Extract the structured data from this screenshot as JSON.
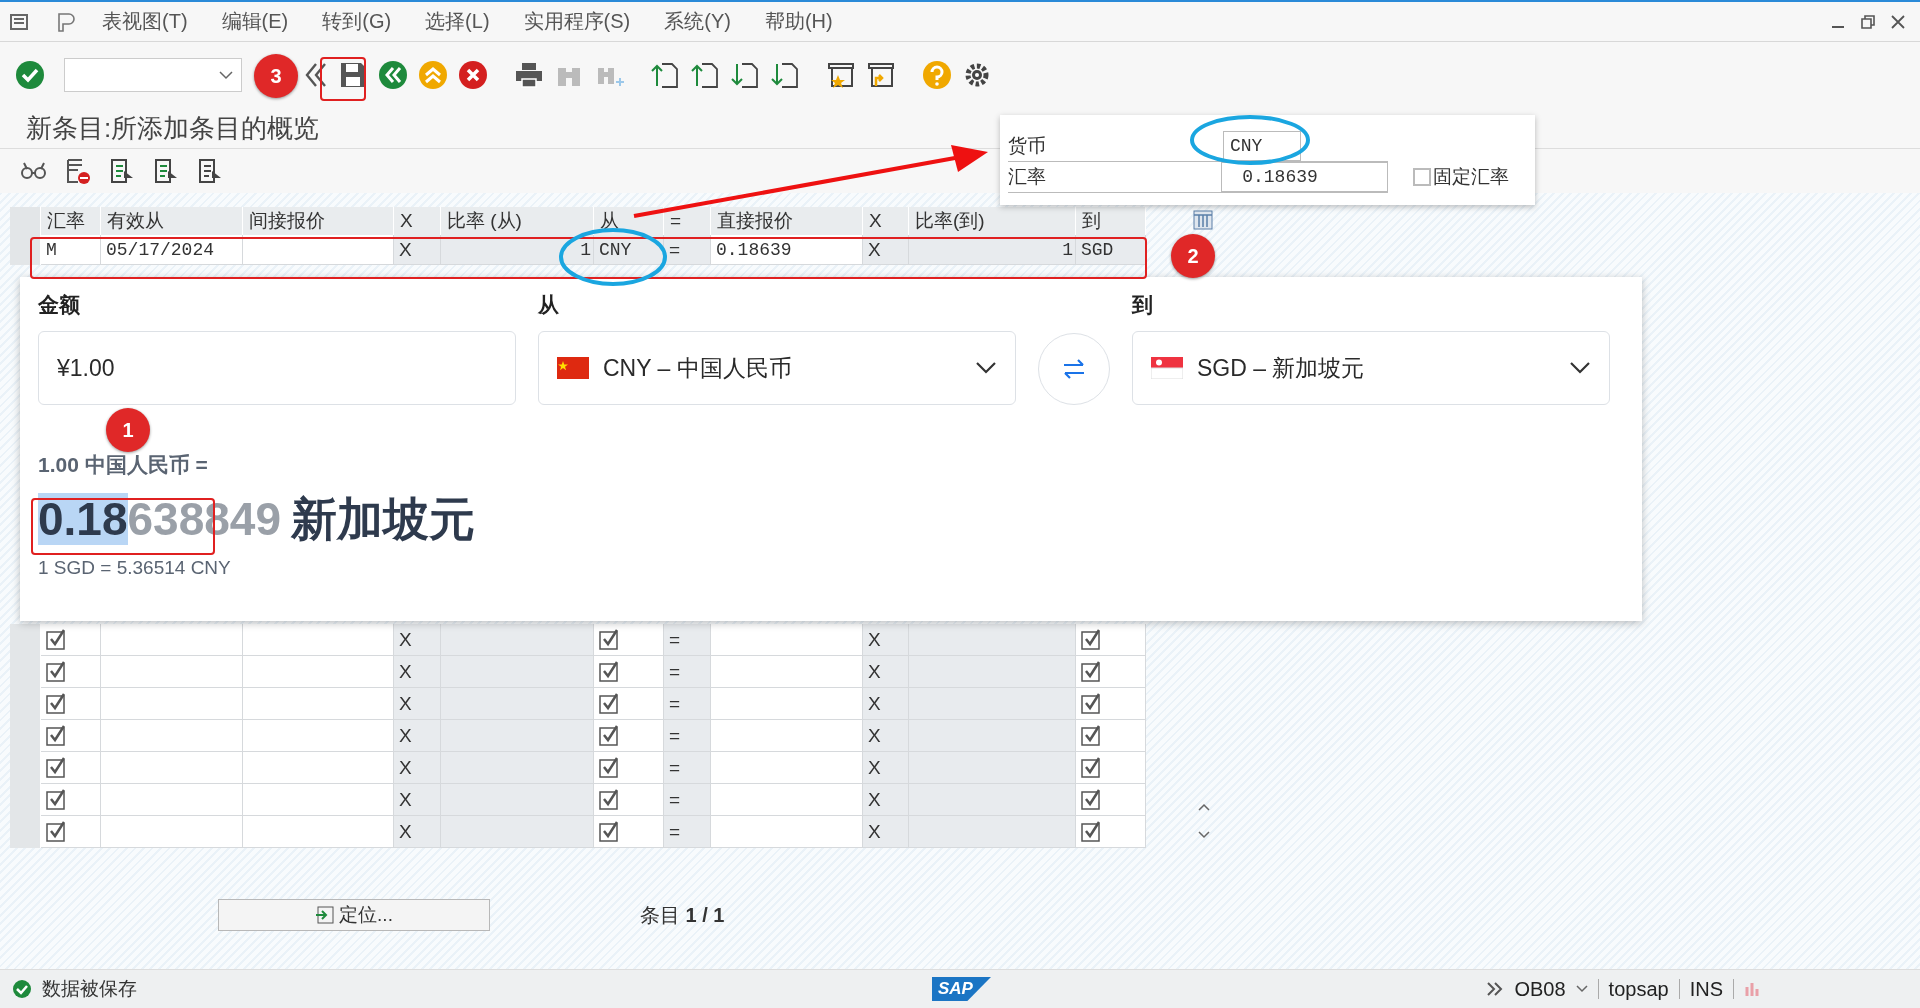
{
  "menu": [
    "表视图(T)",
    "编辑(E)",
    "转到(G)",
    "选择(L)",
    "实用程序(S)",
    "系统(Y)",
    "帮助(H)"
  ],
  "title": "新条目:所添加条目的概览",
  "table": {
    "columns": [
      "汇率",
      "有效从",
      "间接报价",
      "X",
      "比率 (从)",
      "从",
      "=",
      "直接报价",
      "X",
      "比率(到)",
      "到"
    ],
    "row": {
      "rate_type": "M",
      "valid_from": "05/17/2024",
      "x1": "X",
      "ratio_from": "1",
      "from": "CNY",
      "eq": "=",
      "direct_quote": "0.18639",
      "x2": "X",
      "ratio_to": "1",
      "to": "SGD"
    },
    "empty_rows": [
      {
        "checks": [
          true,
          true,
          true
        ],
        "x1": "X",
        "eq": "=",
        "x2": "X"
      },
      {
        "checks": [
          true,
          true,
          true
        ],
        "x1": "X",
        "eq": "=",
        "x2": "X"
      },
      {
        "checks": [
          true,
          true,
          true
        ],
        "x1": "X",
        "eq": "=",
        "x2": "X"
      },
      {
        "checks": [
          true,
          true,
          true
        ],
        "x1": "X",
        "eq": "=",
        "x2": "X"
      },
      {
        "checks": [
          true,
          true,
          true
        ],
        "x1": "X",
        "eq": "=",
        "x2": "X"
      },
      {
        "checks": [
          true,
          true,
          true
        ],
        "x1": "X",
        "eq": "=",
        "x2": "X"
      },
      {
        "checks": [
          true,
          true,
          true
        ],
        "x1": "X",
        "eq": "=",
        "x2": "X"
      }
    ]
  },
  "converter": {
    "amount_label": "金额",
    "amount": "¥1.00",
    "from_label": "从",
    "from_currency": "CNY – 中国人民币",
    "to_label": "到",
    "to_currency": "SGD – 新加坡元",
    "summary": "1.00 中国人民币 =",
    "result_strong": "0.18",
    "result_faded": "638849",
    "result_unit": "新加坡元",
    "inverse": "1 SGD = 5.36514 CNY"
  },
  "popup": {
    "currency_label": "货币",
    "currency": "CNY",
    "rate_label": "汇率",
    "rate": "0.18639",
    "fixed_rate": {
      "label": "固定汇率",
      "checked": false
    }
  },
  "locate_button": "定位...",
  "entries": "条目 **1 / 1**",
  "status": {
    "message": "数据被保存",
    "logo": "SAP",
    "transaction": "OB08",
    "system": "topsap",
    "mode": "INS"
  },
  "markers": [
    "1",
    "2",
    "3"
  ]
}
